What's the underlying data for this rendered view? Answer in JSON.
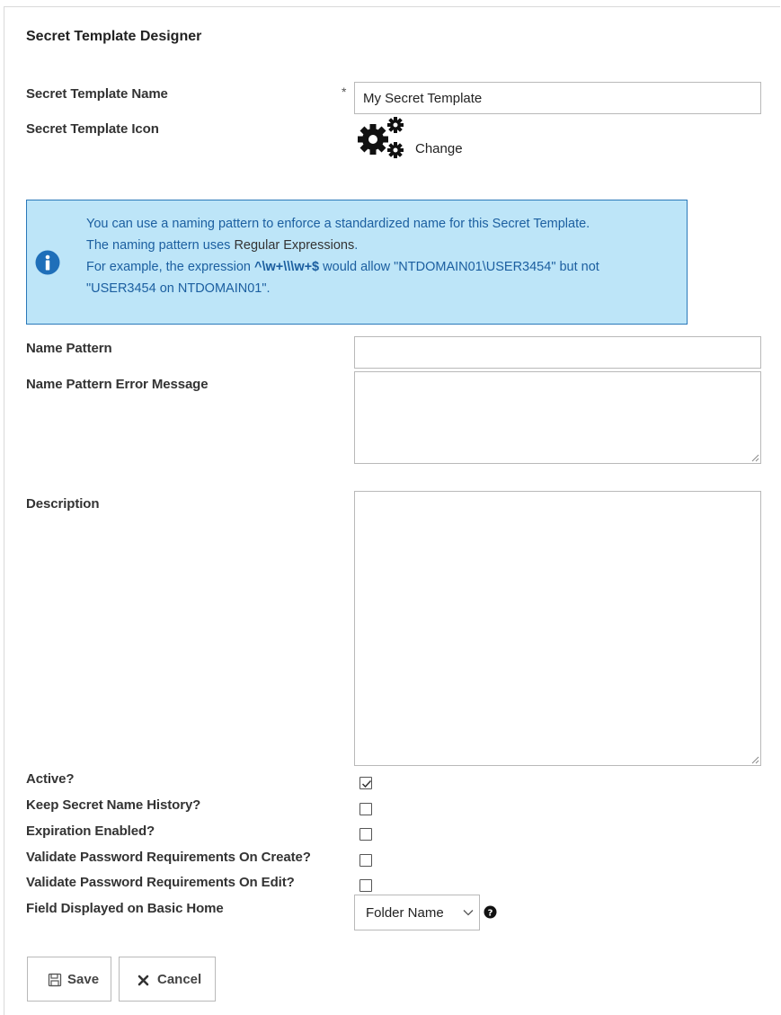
{
  "header": {
    "title": "Secret Template Designer"
  },
  "form": {
    "name_label": "Secret Template Name",
    "required_marker": "*",
    "name_value": "My Secret Template",
    "icon_label": "Secret Template Icon",
    "icon_name": "gears-icon",
    "change_label": "Change",
    "info": {
      "line1": "You can use a naming pattern to enforce a standardized name for this Secret Template.",
      "line2_prefix": "The naming pattern uses ",
      "line2_link": "Regular Expressions",
      "line2_suffix": ".",
      "line3_prefix": "For example, the expression ",
      "line3_expr": "^\\w+\\\\\\w+$",
      "line3_suffix": " would allow \"NTDOMAIN01\\USER3454\" but not",
      "line4": "\"USER3454 on NTDOMAIN01\"."
    },
    "name_pattern_label": "Name Pattern",
    "name_pattern_value": "",
    "error_message_label": "Name Pattern Error Message",
    "error_message_value": "",
    "description_label": "Description",
    "description_value": "",
    "checkboxes": [
      {
        "label": "Active?",
        "checked": true
      },
      {
        "label": "Keep Secret Name History?",
        "checked": false
      },
      {
        "label": "Expiration Enabled?",
        "checked": false
      },
      {
        "label": "Validate Password Requirements On Create?",
        "checked": false
      },
      {
        "label": "Validate Password Requirements On Edit?",
        "checked": false
      }
    ],
    "basic_home_label": "Field Displayed on Basic Home",
    "basic_home_selected": "Folder Name"
  },
  "actions": {
    "save_label": "Save",
    "cancel_label": "Cancel"
  },
  "colors": {
    "info_bg": "#bde5f8",
    "info_border": "#2a78b9",
    "info_text": "#1c5fa0",
    "info_icon": "#1f6fb9"
  }
}
